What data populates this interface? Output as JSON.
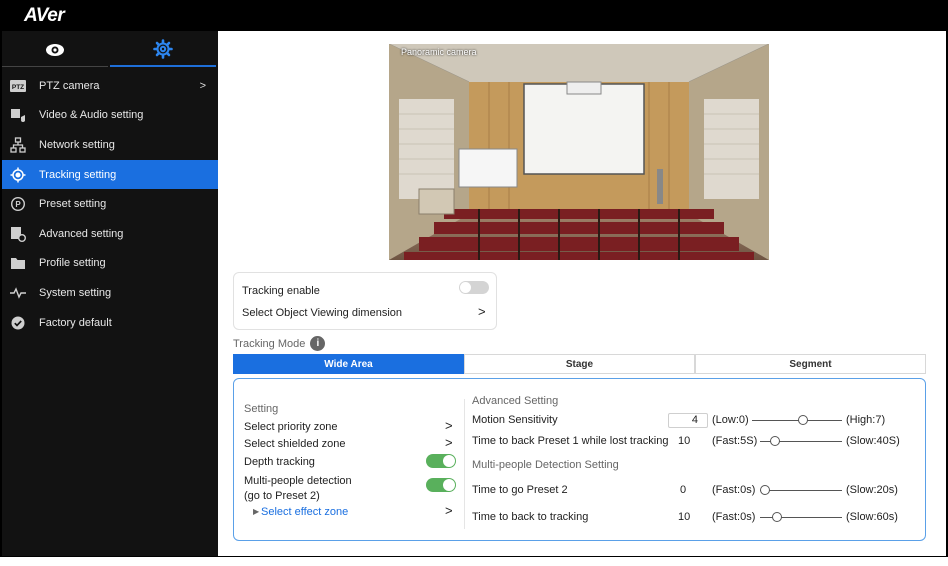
{
  "app": {
    "logo": "AVer"
  },
  "sidebar": {
    "tabs": [
      {
        "icon": "eye-icon"
      },
      {
        "icon": "gear-icon"
      }
    ],
    "items": [
      {
        "label": "PTZ camera",
        "icon": "ptz-icon",
        "chevron": ">"
      },
      {
        "label": "Video & Audio setting",
        "icon": "video-audio-icon"
      },
      {
        "label": "Network setting",
        "icon": "network-icon"
      },
      {
        "label": "Tracking setting",
        "icon": "tracking-icon",
        "active": true
      },
      {
        "label": "Preset setting",
        "icon": "preset-icon"
      },
      {
        "label": "Advanced setting",
        "icon": "advanced-icon"
      },
      {
        "label": "Profile setting",
        "icon": "folder-icon"
      },
      {
        "label": "System setting",
        "icon": "pulse-icon"
      },
      {
        "label": "Factory default",
        "icon": "check-circle-icon"
      }
    ]
  },
  "camera": {
    "label": "Panoramic camera"
  },
  "tracking": {
    "enable_label": "Tracking enable",
    "enable_on": false,
    "dimension_label": "Select Object Viewing dimension",
    "chevron": ">"
  },
  "mode": {
    "label": "Tracking Mode",
    "info_glyph": "i",
    "tabs": [
      "Wide Area",
      "Stage",
      "Segment"
    ],
    "active_tab": 0
  },
  "setting": {
    "header": "Setting",
    "priority_zone": "Select priority zone",
    "shielded_zone": "Select shielded zone",
    "depth_tracking": "Depth tracking",
    "depth_tracking_on": true,
    "multi_people_1": "Multi-people detection",
    "multi_people_2": "(go to Preset 2)",
    "multi_people_on": true,
    "effect_zone": "Select effect zone",
    "effect_zone_marker": "▶",
    "chevron": ">"
  },
  "advanced": {
    "header": "Advanced Setting",
    "motion_label": "Motion Sensitivity",
    "motion_value": "4",
    "motion_low": "(Low:0)",
    "motion_high": "(High:7)",
    "motion_fraction": 0.5714,
    "back_preset1_label": "Time to back Preset 1 while lost tracking",
    "back_preset1_value": "10",
    "back_preset1_low": "(Fast:5S)",
    "back_preset1_high": "(Slow:40S)",
    "back_preset1_fraction": 0.1429,
    "multi_header": "Multi-people Detection Setting",
    "go_preset2_label": "Time to go Preset 2",
    "go_preset2_value": "0",
    "go_preset2_low": "(Fast:0s)",
    "go_preset2_high": "(Slow:20s)",
    "go_preset2_fraction": 0,
    "back_tracking_label": "Time to back to tracking",
    "back_tracking_value": "10",
    "back_tracking_low": "(Fast:0s)",
    "back_tracking_high": "(Slow:60s)",
    "back_tracking_fraction": 0.1667
  },
  "colors": {
    "accent": "#1a6fe0",
    "sidebar_bg": "#121212",
    "toggle_on": "#59b05c",
    "panel_border": "#5aa0e8"
  }
}
